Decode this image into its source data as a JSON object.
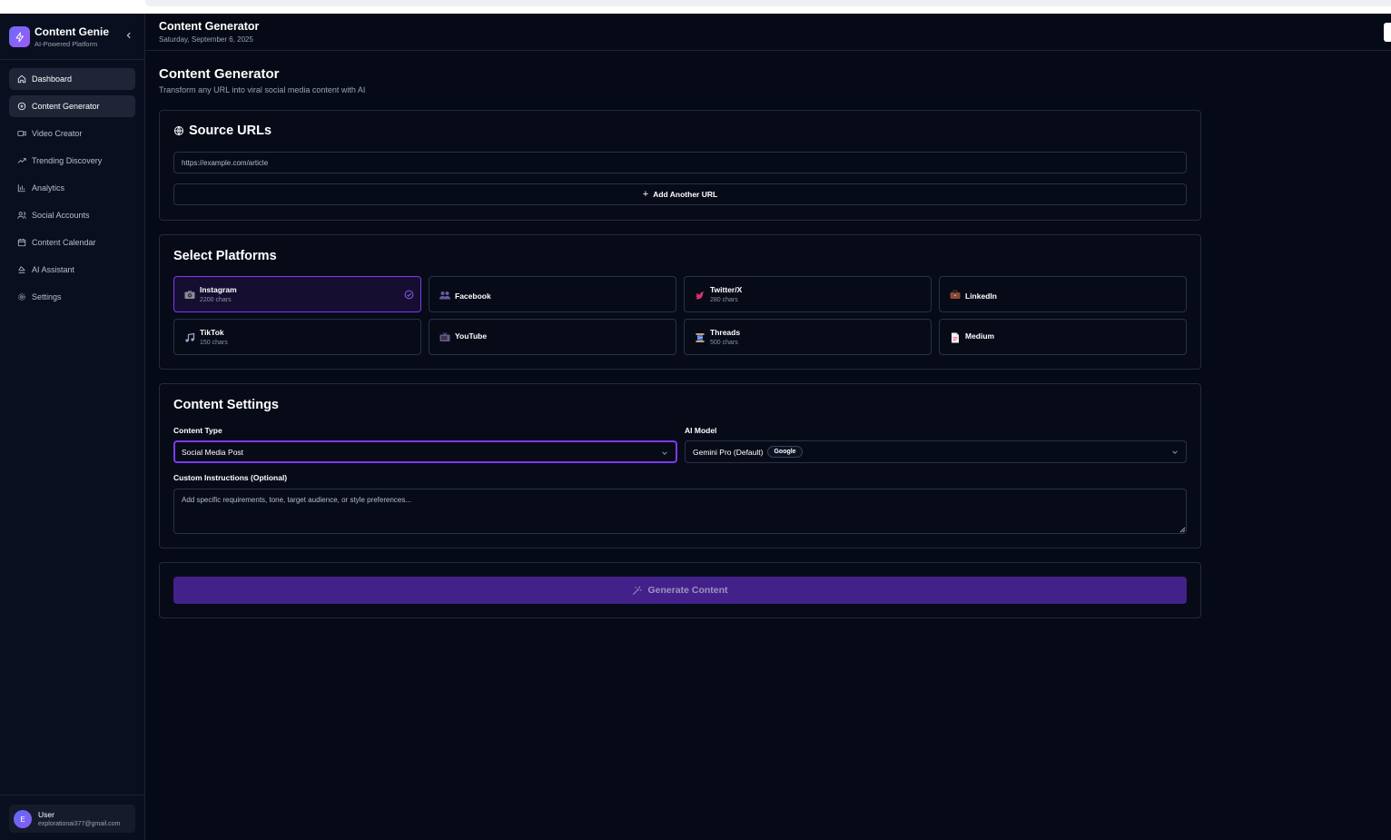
{
  "brand": {
    "title": "Content Genie",
    "subtitle": "AI-Powered Platform"
  },
  "sidebar": {
    "items": [
      {
        "label": "Dashboard",
        "icon": "home-icon"
      },
      {
        "label": "Content Generator",
        "icon": "plus-circle-icon"
      },
      {
        "label": "Video Creator",
        "icon": "video-icon"
      },
      {
        "label": "Trending Discovery",
        "icon": "trending-up-icon"
      },
      {
        "label": "Analytics",
        "icon": "bar-chart-icon"
      },
      {
        "label": "Social Accounts",
        "icon": "users-icon"
      },
      {
        "label": "Content Calendar",
        "icon": "calendar-icon"
      },
      {
        "label": "AI Assistant",
        "icon": "ai-icon"
      },
      {
        "label": "Settings",
        "icon": "gear-icon"
      }
    ],
    "active": "Content Generator"
  },
  "user": {
    "initial": "E",
    "name": "User",
    "email": "explorationai377@gmail.com"
  },
  "header": {
    "title": "Content Generator",
    "date": "Saturday, September 6, 2025"
  },
  "page": {
    "title": "Content Generator",
    "subtitle": "Transform any URL into viral social media content with AI"
  },
  "source_urls": {
    "title": "Source URLs",
    "placeholder": "https://example.com/article",
    "add_button": "Add Another URL"
  },
  "platforms": {
    "title": "Select Platforms",
    "items": [
      {
        "name": "Instagram",
        "chars": "2200 chars",
        "icon": "camera-icon",
        "selected": true
      },
      {
        "name": "Facebook",
        "chars": "",
        "icon": "people-icon",
        "selected": false
      },
      {
        "name": "Twitter/X",
        "chars": "280 chars",
        "icon": "bird-icon",
        "selected": false
      },
      {
        "name": "LinkedIn",
        "chars": "",
        "icon": "briefcase-icon",
        "selected": false
      },
      {
        "name": "TikTok",
        "chars": "150 chars",
        "icon": "music-note-icon",
        "selected": false
      },
      {
        "name": "YouTube",
        "chars": "",
        "icon": "tv-icon",
        "selected": false
      },
      {
        "name": "Threads",
        "chars": "500 chars",
        "icon": "spool-icon",
        "selected": false
      },
      {
        "name": "Medium",
        "chars": "",
        "icon": "document-icon",
        "selected": false
      }
    ]
  },
  "settings": {
    "title": "Content Settings",
    "content_type_label": "Content Type",
    "content_type_value": "Social Media Post",
    "ai_model_label": "AI Model",
    "ai_model_value": "Gemini Pro (Default)",
    "ai_model_badge": "Google",
    "instructions_label": "Custom Instructions (Optional)",
    "instructions_placeholder": "Add specific requirements, tone, target audience, or style preferences..."
  },
  "generate": {
    "label": "Generate Content"
  },
  "colors": {
    "accent": "#7c3aed",
    "background": "#060916",
    "generate_button": "#43218a"
  }
}
